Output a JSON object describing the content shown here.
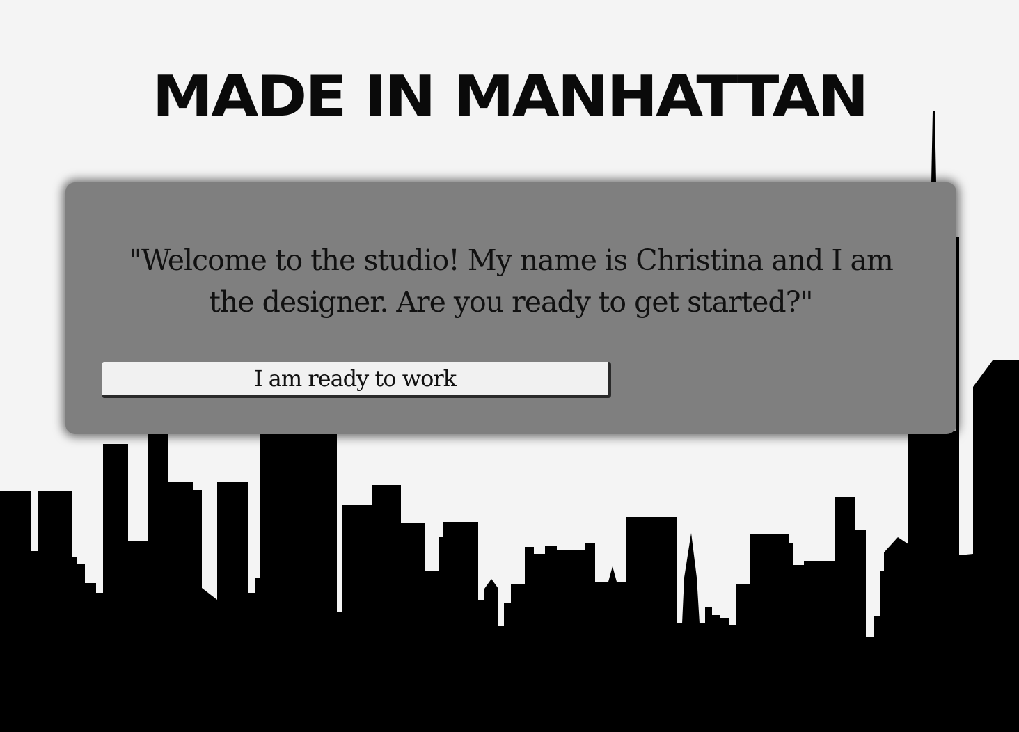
{
  "page": {
    "title": "MADE IN MANHATTAN",
    "background_color": "#f4f4f4"
  },
  "dialog": {
    "message": "\"Welcome to the studio! My name is Christina and I am the designer. Are you ready to get started?\"",
    "background_color": "#7f7f7f"
  },
  "actions": {
    "ready_button_label": "I am ready to work"
  },
  "skyline": {
    "color": "#000000"
  }
}
